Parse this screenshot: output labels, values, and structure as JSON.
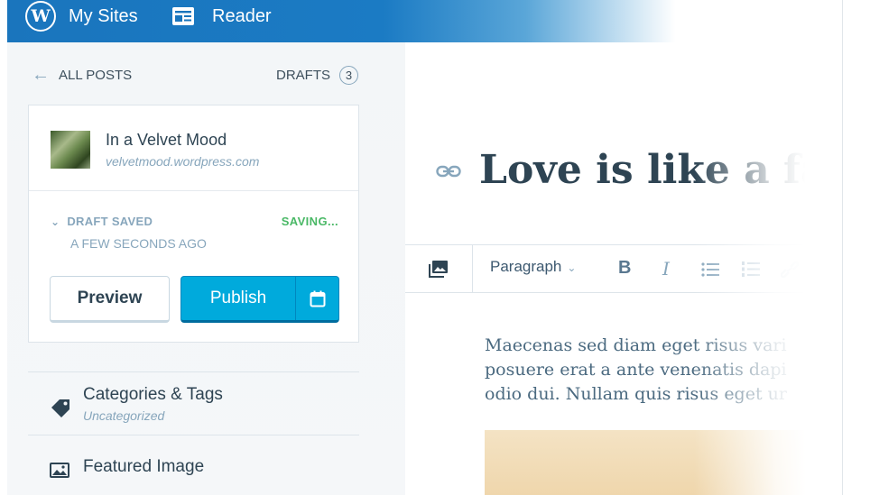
{
  "masterbar": {
    "my_sites": "My Sites",
    "reader": "Reader"
  },
  "sidebar": {
    "back_label": "ALL POSTS",
    "drafts_label": "DRAFTS",
    "drafts_count": "3",
    "site": {
      "title": "In a Velvet Mood",
      "url": "velvetmood.wordpress.com"
    },
    "status": {
      "saved_label": "DRAFT SAVED",
      "saved_time": "A FEW SECONDS AGO",
      "saving_label": "SAVING..."
    },
    "buttons": {
      "preview": "Preview",
      "publish": "Publish"
    },
    "sections": [
      {
        "title": "Categories & Tags",
        "subtitle": "Uncategorized",
        "icon": "tag-icon"
      },
      {
        "title": "Featured Image",
        "icon": "image-icon"
      }
    ]
  },
  "editor": {
    "title": "Love is like a fa",
    "toolbar": {
      "format": "Paragraph",
      "bold": "B",
      "italic": "I"
    },
    "body_lines": [
      "Maecenas sed diam eget risus vari",
      "posuere erat a ante venenatis dapi",
      "odio dui. Nullam quis risus eget ur"
    ]
  },
  "colors": {
    "brand": "#1a75bd",
    "accent": "#00aadc",
    "saving": "#4ab866",
    "muted": "#87a6bc"
  }
}
